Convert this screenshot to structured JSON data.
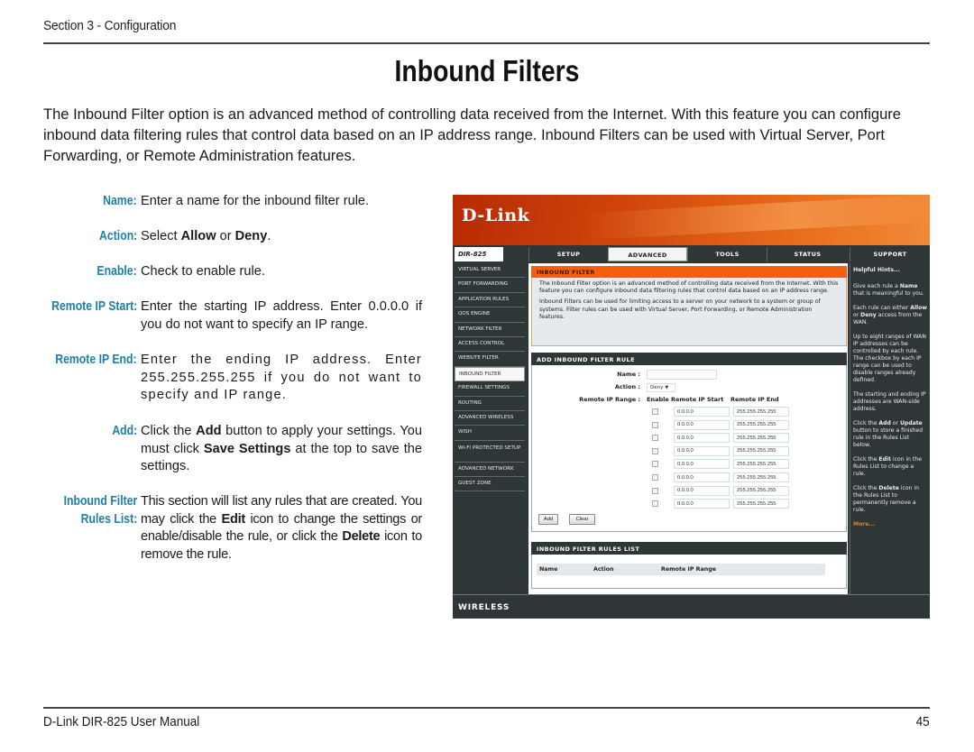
{
  "header": {
    "section": "Section 3 - Configuration",
    "title": "Inbound Filters"
  },
  "intro": "The Inbound Filter option is an advanced method of controlling data received from the Internet. With this feature you can configure inbound data filtering rules that control data based on an IP address range.  Inbound Filters can be used with Virtual Server, Port Forwarding, or Remote Administration features.",
  "descriptions": [
    {
      "label": "Name:",
      "html_parts": [
        "Enter a name for the inbound filter rule."
      ]
    },
    {
      "label": "Action:",
      "pre": "Select ",
      "b1": "Allow",
      "mid": " or ",
      "b2": "Deny",
      "post": "."
    },
    {
      "label": "Enable:",
      "text": "Check to enable rule."
    },
    {
      "label": "Remote IP Start:",
      "text": "Enter the starting IP address. Enter 0.0.0.0 if you do not want to specify an IP range."
    },
    {
      "label": "Remote IP End:",
      "text": "Enter the ending IP address. Enter 255.255.255.255 if you do not want to specify and IP range."
    },
    {
      "label": "Add:",
      "pre": "Click the ",
      "b1": "Add",
      "mid": " button to apply your settings. You must click ",
      "b2": "Save Settings",
      "post": " at the top to save the settings."
    },
    {
      "label_line1": "Inbound Filter",
      "label_line2": "Rules List:",
      "pre": "This section will list any rules that are created. You may click the ",
      "b1": "Edit",
      "mid": " icon to change the settings or enable/disable the rule, or click the ",
      "b2": "Delete",
      "post": " icon to remove the rule."
    }
  ],
  "router": {
    "brand": "D-Link",
    "model": "DIR-825",
    "tabs": [
      "SETUP",
      "ADVANCED",
      "TOOLS",
      "STATUS",
      "SUPPORT"
    ],
    "active_tab": "ADVANCED",
    "sidebar": [
      "VIRTUAL SERVER",
      "PORT FORWARDING",
      "APPLICATION RULES",
      "QOS ENGINE",
      "NETWORK FILTER",
      "ACCESS CONTROL",
      "WEBSITE FILTER",
      "INBOUND FILTER",
      "FIREWALL SETTINGS",
      "ROUTING",
      "ADVANCED WIRELESS",
      "WISH",
      "WI-FI PROTECTED SETUP",
      "ADVANCED NETWORK",
      "GUEST ZONE"
    ],
    "active_sidebar": "INBOUND FILTER",
    "inbound_filter": {
      "title": "INBOUND FILTER",
      "para1": "The Inbound Filter option is an advanced method of controlling data received from the Internet. With this feature you can configure inbound data filtering rules that control data based on an IP address range.",
      "para2": "Inbound Filters can be used for limiting access to a server on your network to a system or group of systems. Filter rules can be used with Virtual Server, Port Forwarding, or Remote Administration features."
    },
    "add_rule": {
      "title": "ADD INBOUND FILTER RULE",
      "name_label": "Name :",
      "name_value": "",
      "action_label": "Action :",
      "action_value": "Deny",
      "range_label": "Remote IP Range :",
      "col_enable": "Enable",
      "col_start": "Remote IP Start",
      "col_end": "Remote IP End",
      "rows": [
        {
          "enabled": false,
          "start": "0.0.0.0",
          "end": "255.255.255.255"
        },
        {
          "enabled": false,
          "start": "0.0.0.0",
          "end": "255.255.255.255"
        },
        {
          "enabled": false,
          "start": "0.0.0.0",
          "end": "255.255.255.255"
        },
        {
          "enabled": false,
          "start": "0.0.0.0",
          "end": "255.255.255.255"
        },
        {
          "enabled": false,
          "start": "0.0.0.0",
          "end": "255.255.255.255"
        },
        {
          "enabled": false,
          "start": "0.0.0.0",
          "end": "255.255.255.255"
        },
        {
          "enabled": false,
          "start": "0.0.0.0",
          "end": "255.255.255.255"
        },
        {
          "enabled": false,
          "start": "0.0.0.0",
          "end": "255.255.255.255"
        }
      ],
      "add_button": "Add",
      "clear_button": "Clear"
    },
    "rules_list": {
      "title": "INBOUND FILTER RULES LIST",
      "columns": [
        "Name",
        "Action",
        "Remote IP Range"
      ]
    },
    "hints": {
      "title": "Helpful Hints...",
      "items": [
        {
          "pre": "Give each rule a ",
          "b": "Name",
          "post": " that is meaningful to you."
        },
        {
          "pre": "Each rule can either ",
          "b": "Allow",
          "mid": " or ",
          "b2": "Deny",
          "post": " access from the WAN."
        },
        {
          "pre": "Up to eight ranges of WAN IP addresses can be controlled by each rule. The checkbox by each IP range can be used to disable ranges already defined."
        },
        {
          "pre": "The starting and ending IP addresses are WAN-side address."
        },
        {
          "pre": "Click the ",
          "b": "Add",
          "mid": " or ",
          "b2": "Update",
          "post": " button to store a finished rule in the Rules List below."
        },
        {
          "pre": "Click the ",
          "b": "Edit",
          "post": " icon in the Rules List to change a rule."
        },
        {
          "pre": "Click the ",
          "b": "Delete",
          "post": " icon in the Rules List to permanently remove a rule."
        }
      ],
      "more": "More..."
    },
    "footer": "WIRELESS",
    "colors": {
      "banner": "#d0440a",
      "orange_header": "#f55e0c",
      "dark": "#2f3638",
      "more_link": "#d48a22"
    }
  },
  "footer": {
    "manual": "D-Link DIR-825 User Manual",
    "page": "45"
  },
  "colors": {
    "label_blue": "#1c7fa6"
  }
}
